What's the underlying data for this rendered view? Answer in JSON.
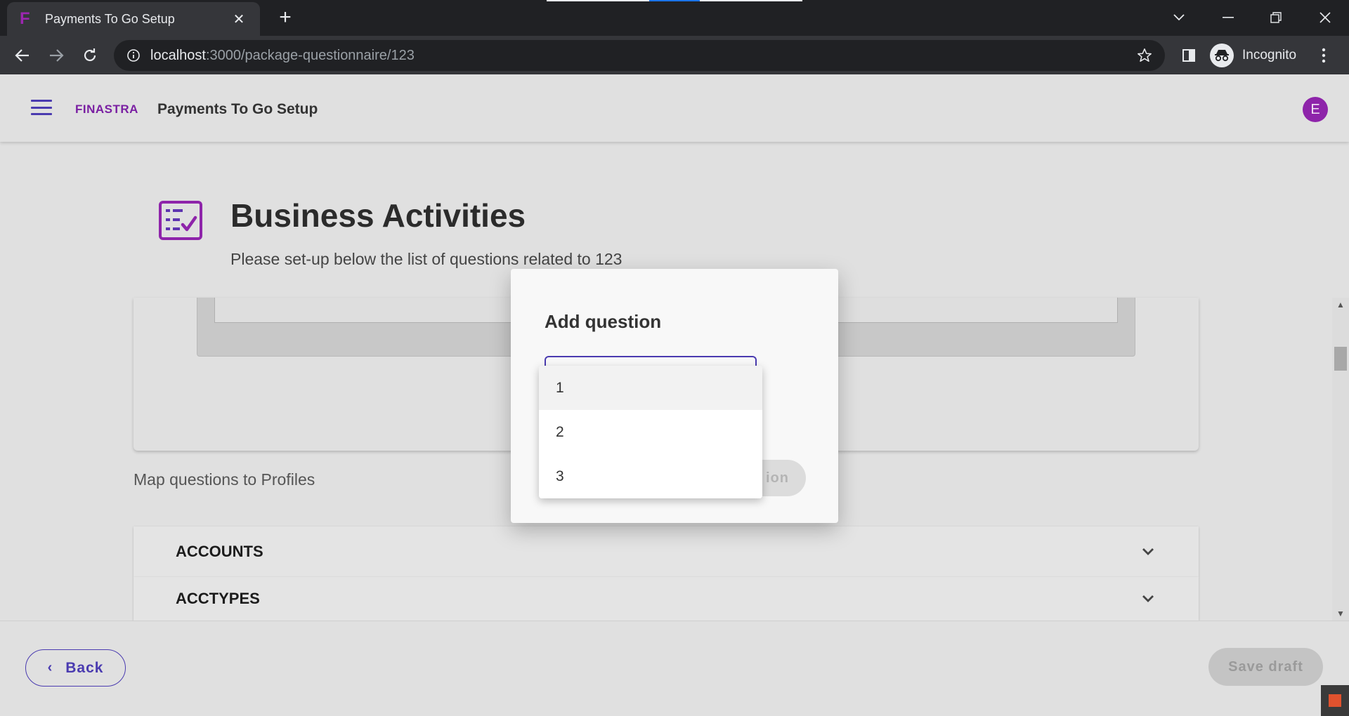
{
  "browser": {
    "tab_title": "Payments To Go Setup",
    "tab_favicon": "F",
    "url_host": "localhost",
    "url_path": ":3000/package-questionnaire/123",
    "profile_label": "Incognito"
  },
  "header": {
    "brand": "FINASTRA",
    "app_title": "Payments To Go Setup",
    "user_initial": "E"
  },
  "page": {
    "title": "Business Activities",
    "subtitle": "Please set-up below the list of questions related to 123",
    "map_label": "Map questions to Profiles",
    "accordion": [
      {
        "label": "ACCOUNTS"
      },
      {
        "label": "ACCTYPES"
      }
    ]
  },
  "footer": {
    "back_label": "Back",
    "save_label": "Save draft"
  },
  "modal": {
    "title": "Add question",
    "action_label": "ion",
    "dropdown_options": [
      "1",
      "2",
      "3"
    ],
    "highlighted_option": "1"
  },
  "colors": {
    "accent": "#4a3bb0",
    "brand": "#7a1fa2",
    "avatar": "#8e24aa"
  }
}
